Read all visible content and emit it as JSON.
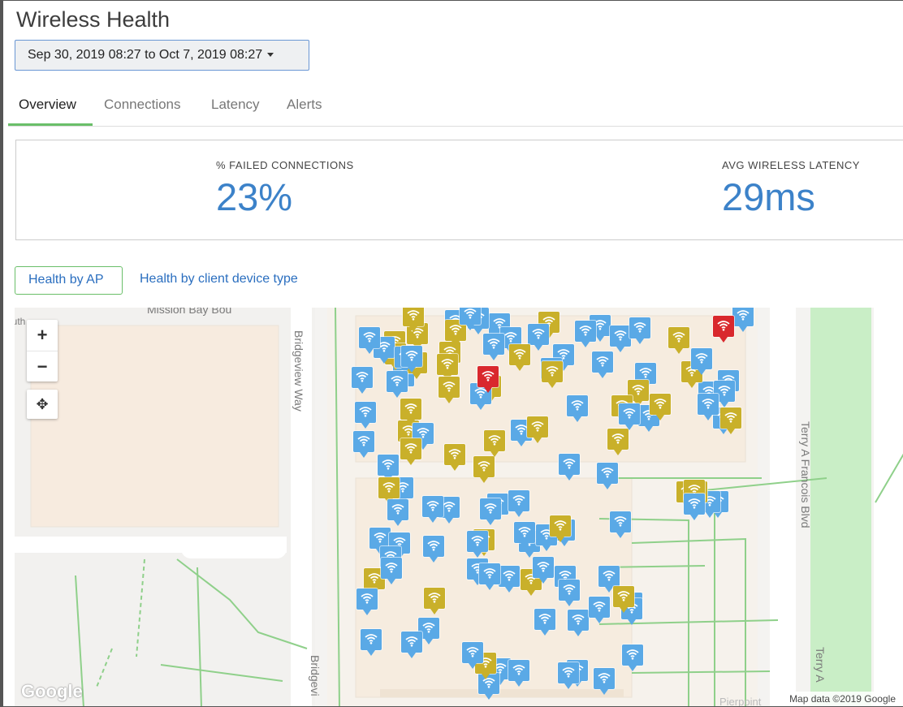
{
  "page": {
    "title": "Wireless Health"
  },
  "date_range": {
    "label": "Sep 30, 2019 08:27 to Oct 7, 2019 08:27"
  },
  "tabs": [
    {
      "label": "Overview",
      "active": true
    },
    {
      "label": "Connections",
      "active": false
    },
    {
      "label": "Latency",
      "active": false
    },
    {
      "label": "Alerts",
      "active": false
    }
  ],
  "stats": {
    "failed_connections": {
      "label": "% FAILED CONNECTIONS",
      "value": "23%"
    },
    "avg_latency": {
      "label": "AVG WIRELESS LATENCY",
      "value": "29ms"
    }
  },
  "health_view": {
    "by_ap_label": "Health by AP",
    "by_client_label": "Health by client device type"
  },
  "map": {
    "streets": {
      "mission_bay": "Mission Bay Bou",
      "bridgeview_way": "Bridgeview Way",
      "bridgeview_bottom": "Bridgevi",
      "terry_francois": "Terry A Francois Blvd",
      "terry_bottom": "Terry A",
      "south": "South",
      "pierpoint": "Pierpoint"
    },
    "google_logo": "Google",
    "attribution": "Map data ©2019 Google",
    "zoom_in": "+",
    "zoom_out": "−",
    "locate_icon": "crosshair-icon",
    "status_colors": {
      "good": "#5aa9e6",
      "warning": "#c9b02a",
      "critical": "#d9282d"
    },
    "access_point_counts": {
      "good": 85,
      "warning": 38,
      "critical": 2
    }
  },
  "colors": {
    "accent": "#3c82c9",
    "active_tab": "#6abf69"
  }
}
